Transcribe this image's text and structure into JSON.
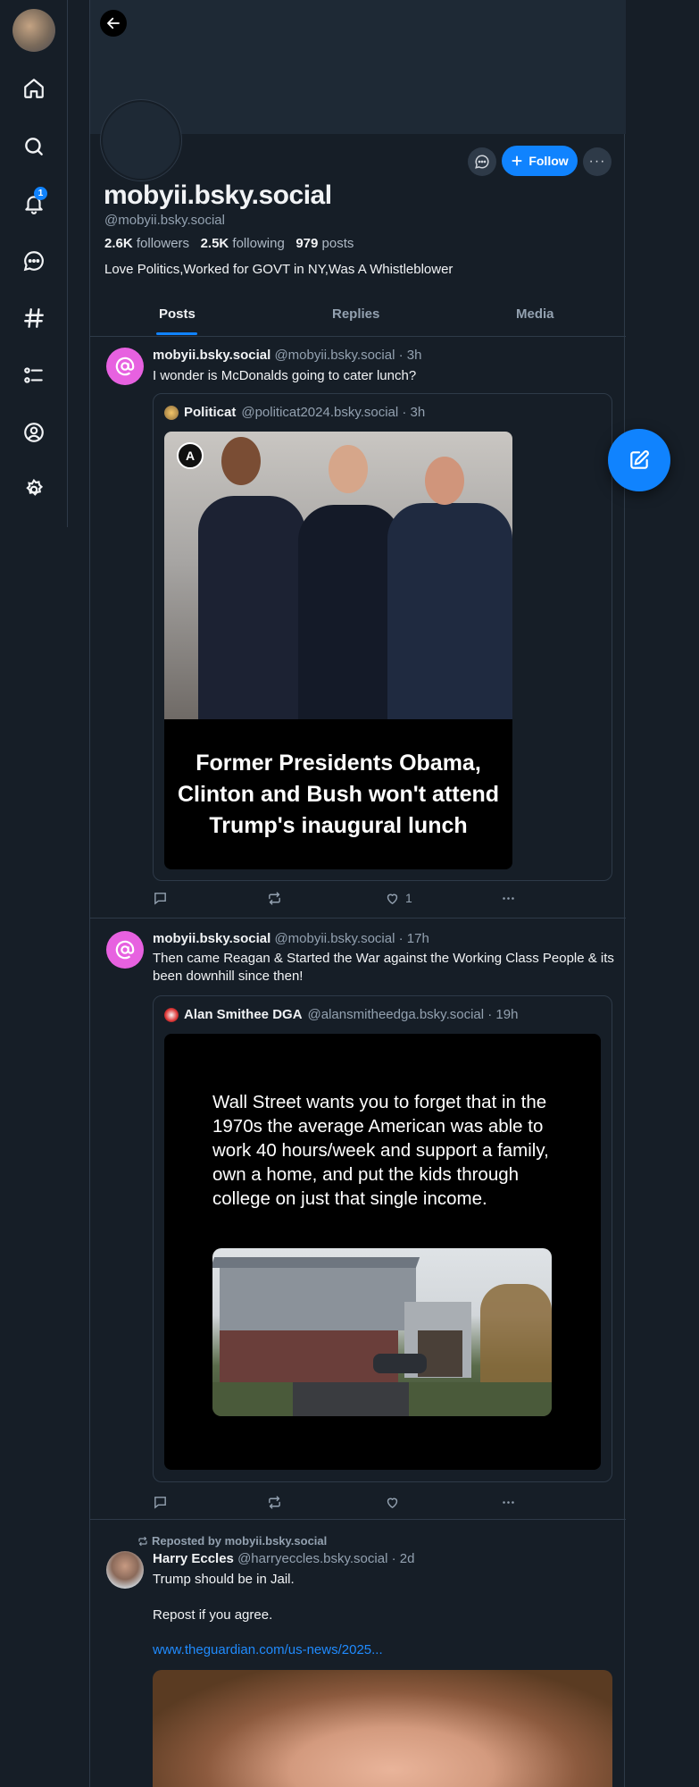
{
  "nav": {
    "notification_count": "1",
    "items": [
      "home-icon",
      "search-icon",
      "bell-icon",
      "chat-icon",
      "hashtag-icon",
      "list-icon",
      "profile-icon",
      "settings-icon"
    ]
  },
  "profile": {
    "display_name": "mobyii.bsky.social",
    "handle": "@mobyii.bsky.social",
    "followers_count": "2.6K",
    "followers_label": "followers",
    "following_count": "2.5K",
    "following_label": "following",
    "posts_count": "979",
    "posts_label": "posts",
    "bio": "Love Politics,Worked for GOVT in NY,Was A Whistleblower",
    "follow_label": "Follow",
    "more_label": "···"
  },
  "tabs": [
    "Posts",
    "Replies",
    "Media"
  ],
  "posts": [
    {
      "name": "mobyii.bsky.social",
      "meta": "@mobyii.bsky.social · 3h",
      "text": "I wonder is McDonalds going to cater lunch?",
      "quote": {
        "name": "Politicat",
        "meta": "@politicat2024.bsky.social · 3h",
        "image_caption": "Former Presidents Obama, Clinton and Bush won't attend Trump's inaugural lunch"
      },
      "like_count": "1"
    },
    {
      "name": "mobyii.bsky.social",
      "meta": "@mobyii.bsky.social · 17h",
      "text": "Then came Reagan & Started the War against the Working Class People & its been downhill since then!",
      "quote": {
        "name": "Alan Smithee DGA",
        "meta": "@alansmitheedga.bsky.social · 19h",
        "image_text": "Wall Street wants you to forget that in the 1970s the average American was able to work 40 hours/week and support a family, own a home, and put the kids through college on just that single income."
      },
      "like_count": ""
    },
    {
      "repost_label": "Reposted by mobyii.bsky.social",
      "name": "Harry Eccles",
      "meta": "@harryeccles.bsky.social · 2d",
      "text_line1": "Trump should be in Jail.",
      "text_line2": "Repost if you agree.",
      "link": "www.theguardian.com/us-news/2025..."
    }
  ],
  "colors": {
    "background": "#161e27",
    "accent": "#1083fe",
    "border": "#2e3a48",
    "muted_text": "#93a1b0"
  }
}
